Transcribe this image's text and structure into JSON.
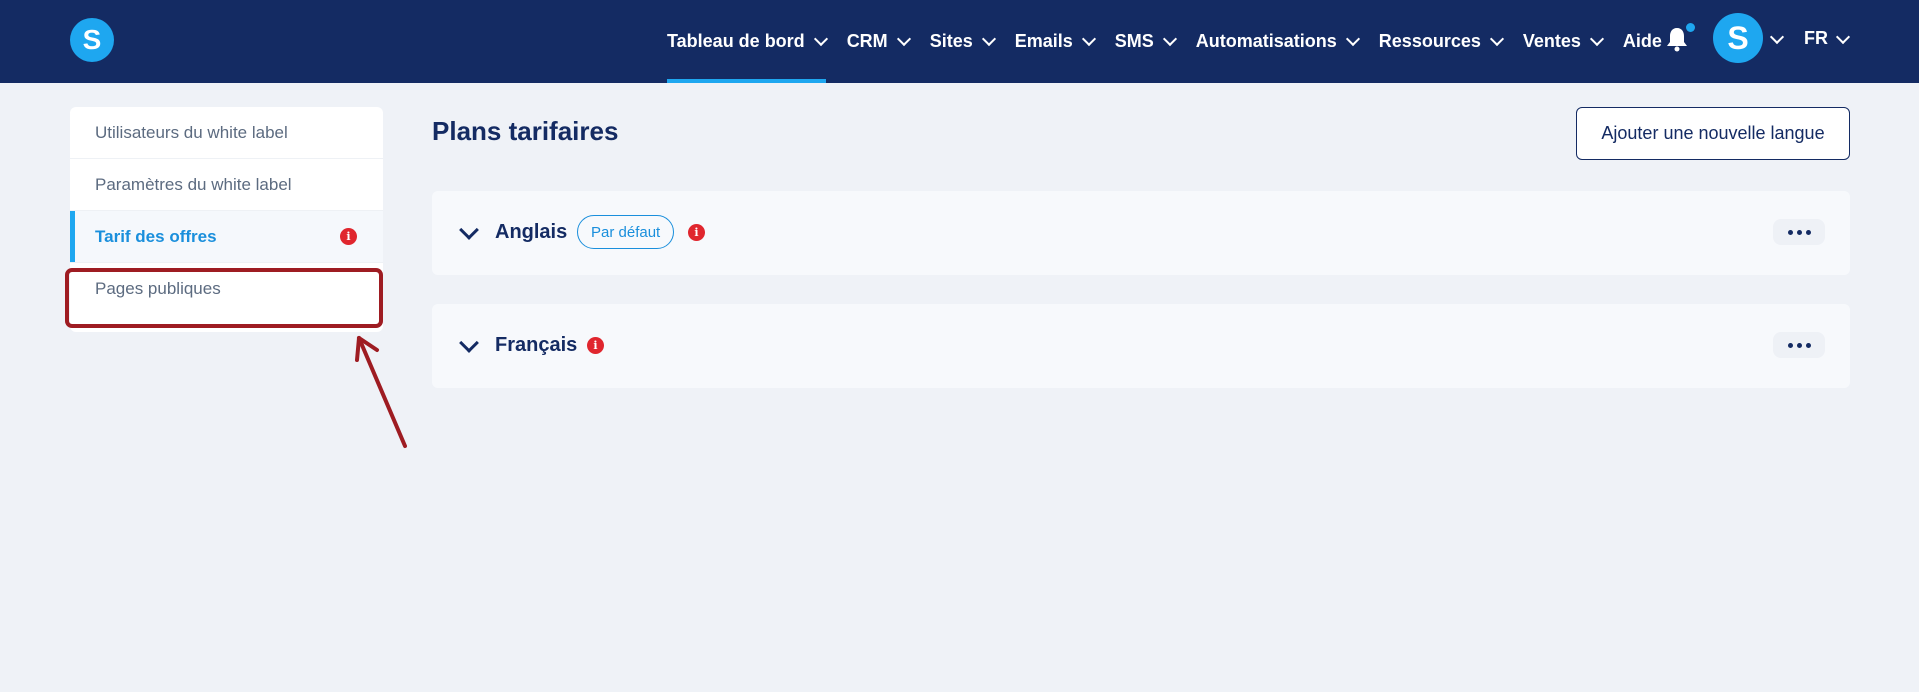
{
  "header": {
    "logo_letter": "S",
    "nav": [
      {
        "label": "Tableau de bord",
        "active": true
      },
      {
        "label": "CRM"
      },
      {
        "label": "Sites"
      },
      {
        "label": "Emails"
      },
      {
        "label": "SMS"
      },
      {
        "label": "Automatisations"
      },
      {
        "label": "Ressources"
      },
      {
        "label": "Ventes"
      },
      {
        "label": "Aide"
      }
    ],
    "avatar_letter": "S",
    "language": "FR"
  },
  "sidebar": {
    "items": [
      {
        "label": "Utilisateurs du white label"
      },
      {
        "label": "Paramètres du white label"
      },
      {
        "label": "Tarif des offres",
        "active": true,
        "warning": true
      },
      {
        "label": "Pages publiques",
        "highlighted": true
      }
    ]
  },
  "main": {
    "title": "Plans tarifaires",
    "add_language_button": "Ajouter une nouvelle langue",
    "languages": [
      {
        "name": "Anglais",
        "badge": "Par défaut",
        "warning": true
      },
      {
        "name": "Français",
        "warning": true
      }
    ]
  },
  "colors": {
    "topbar": "#142b63",
    "accent": "#1ea7f0",
    "warning": "#e0262e",
    "annotation": "#9e1c22"
  }
}
